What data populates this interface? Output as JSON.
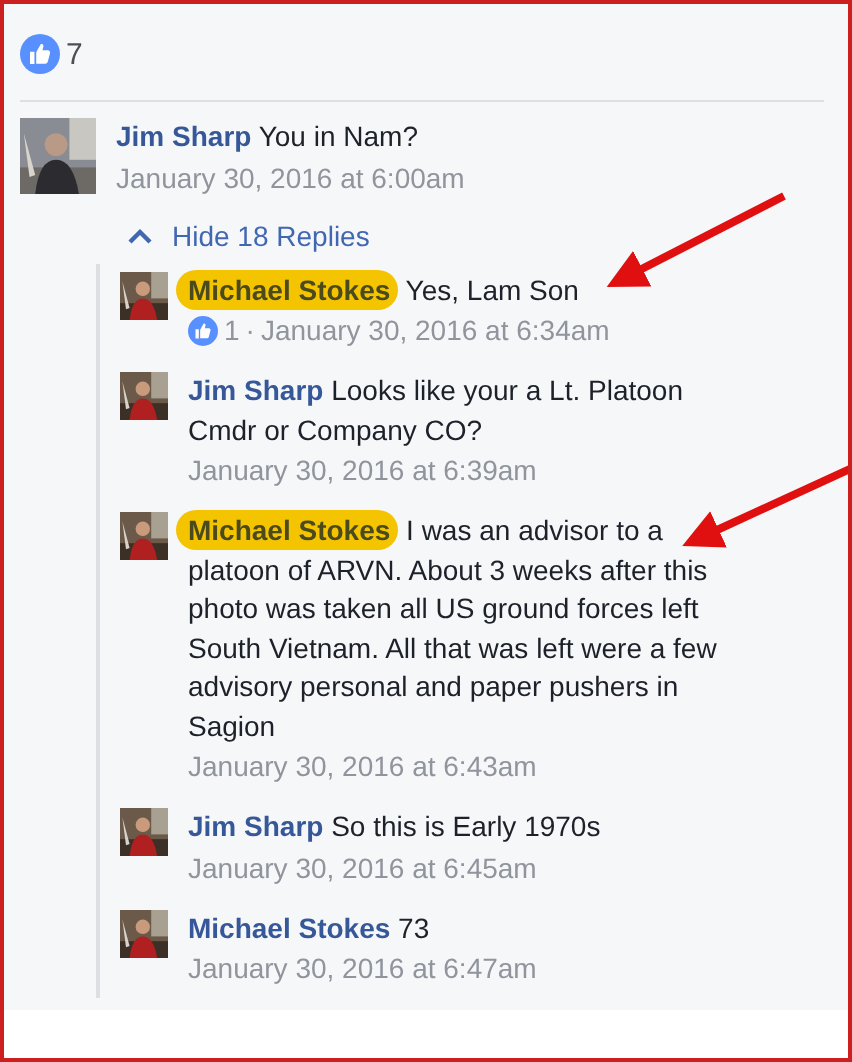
{
  "reactions": {
    "count": "7"
  },
  "comment": {
    "author": "Jim Sharp",
    "text": "You in Nam?",
    "time": "January 30, 2016 at 6:00am"
  },
  "replies_toggle": {
    "label": "Hide 18 Replies",
    "expanded": true
  },
  "replies": [
    {
      "author": "Michael Stokes",
      "text": "Yes, Lam Son",
      "likes": "1",
      "separator": "·",
      "time": "January 30, 2016 at 6:34am",
      "highlighted": true
    },
    {
      "author": "Jim Sharp",
      "text": "Looks like your a Lt. Platoon Cmdr or Company CO?",
      "time": "January 30, 2016 at 6:39am",
      "highlighted": false
    },
    {
      "author": "Michael Stokes",
      "text": "I was an advisor to a platoon of ARVN. About 3 weeks after this photo was taken all US ground forces left South Vietnam. All that was left were a few advisory personal and paper pushers in Sagion",
      "time": "January 30, 2016 at 6:43am",
      "highlighted": true
    },
    {
      "author": "Jim Sharp",
      "text": "So this is Early 1970s",
      "time": "January 30, 2016 at 6:45am",
      "highlighted": false
    },
    {
      "author": "Michael Stokes",
      "text": "73",
      "time": "January 30, 2016 at 6:47am",
      "highlighted": false
    }
  ]
}
